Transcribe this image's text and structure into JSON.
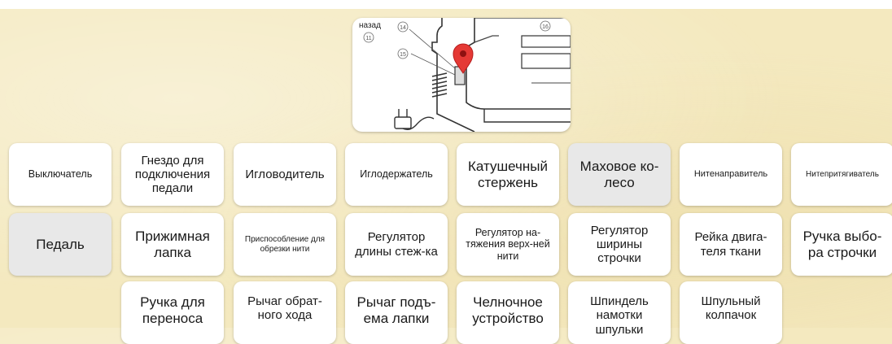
{
  "diagram": {
    "back_label": "назад",
    "callouts": [
      "11",
      "14",
      "15",
      "16"
    ]
  },
  "tiles": [
    {
      "label": "Выключатель"
    },
    {
      "label": "Гнездо для подключения педали"
    },
    {
      "label": "Игловодитель"
    },
    {
      "label": "Иглодержатель"
    },
    {
      "label": "Катушечный стержень"
    },
    {
      "label": "Маховое ко-лесо",
      "selected": true
    },
    {
      "label": "Нитенаправитель"
    },
    {
      "label": "Нитепритягиватель"
    },
    {
      "label": "Педаль",
      "selected": true
    },
    {
      "label": "Прижимная лапка"
    },
    {
      "label": "Приспособление для обрезки нити"
    },
    {
      "label": "Регулятор длины стеж-ка"
    },
    {
      "label": "Регулятор на-тяжения верх-ней нити"
    },
    {
      "label": "Регулятор ширины строчки"
    },
    {
      "label": "Рейка двига-теля ткани"
    },
    {
      "label": "Ручка выбо-ра строчки"
    },
    {
      "label": "Ручка для переноса"
    },
    {
      "label": "Рычаг обрат-ного хода"
    },
    {
      "label": "Рычаг подъ-ема лапки"
    },
    {
      "label": "Челночное устройство"
    },
    {
      "label": "Шпиндель намотки шпульки"
    },
    {
      "label": "Шпульный колпачок"
    }
  ]
}
